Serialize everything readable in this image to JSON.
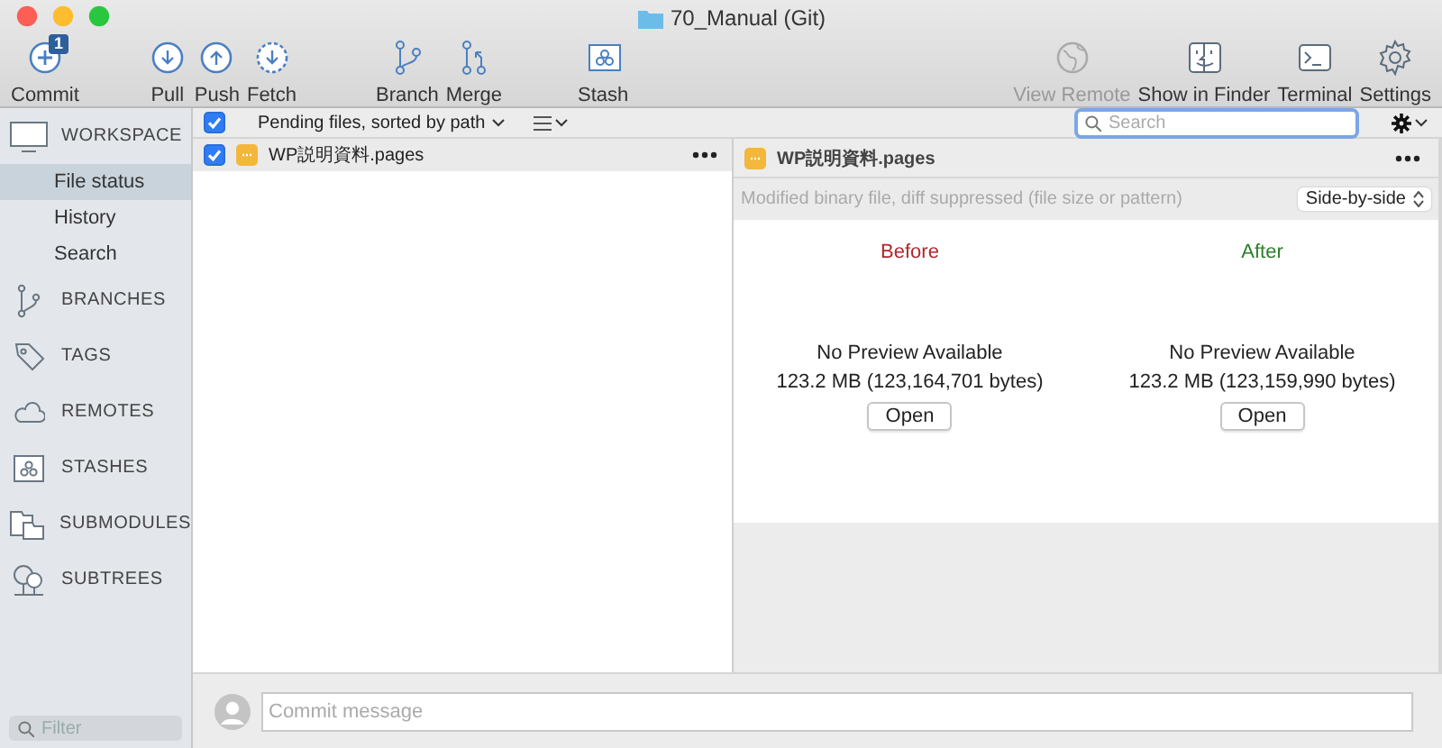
{
  "window": {
    "title": "70_Manual (Git)"
  },
  "toolbar": {
    "items": [
      {
        "label": "Commit",
        "badge": "1",
        "disabled": false
      },
      {
        "label": "Pull",
        "disabled": false
      },
      {
        "label": "Push",
        "disabled": false
      },
      {
        "label": "Fetch",
        "disabled": false
      },
      {
        "label": "Branch",
        "disabled": false
      },
      {
        "label": "Merge",
        "disabled": false
      },
      {
        "label": "Stash",
        "disabled": false
      },
      {
        "label": "View Remote",
        "disabled": true
      },
      {
        "label": "Show in Finder",
        "disabled": false
      },
      {
        "label": "Terminal",
        "disabled": false
      },
      {
        "label": "Settings",
        "disabled": false
      }
    ]
  },
  "sidebar": {
    "sections": [
      {
        "label": "WORKSPACE",
        "children": [
          {
            "label": "File status",
            "selected": true
          },
          {
            "label": "History",
            "selected": false
          },
          {
            "label": "Search",
            "selected": false
          }
        ]
      },
      {
        "label": "BRANCHES"
      },
      {
        "label": "TAGS"
      },
      {
        "label": "REMOTES"
      },
      {
        "label": "STASHES"
      },
      {
        "label": "SUBMODULES"
      },
      {
        "label": "SUBTREES"
      }
    ],
    "filter": {
      "placeholder": "Filter"
    }
  },
  "file_list": {
    "select_all": {
      "checked": true
    },
    "sort_label": "Pending files, sorted by path",
    "files": [
      {
        "name": "WP説明資料.pages",
        "checked": true
      }
    ]
  },
  "search": {
    "placeholder": "Search"
  },
  "diff": {
    "file_name": "WP説明資料.pages",
    "message": "Modified binary file, diff suppressed (file size or pattern)",
    "view_mode": "Side-by-side",
    "panes": [
      {
        "kind": "before",
        "heading": "Before",
        "status": "No Preview Available",
        "size": "123.2 MB (123,164,701 bytes)",
        "button": "Open"
      },
      {
        "kind": "after",
        "heading": "After",
        "status": "No Preview Available",
        "size": "123.2 MB (123,159,990 bytes)",
        "button": "Open"
      }
    ]
  },
  "commit": {
    "placeholder": "Commit message"
  }
}
